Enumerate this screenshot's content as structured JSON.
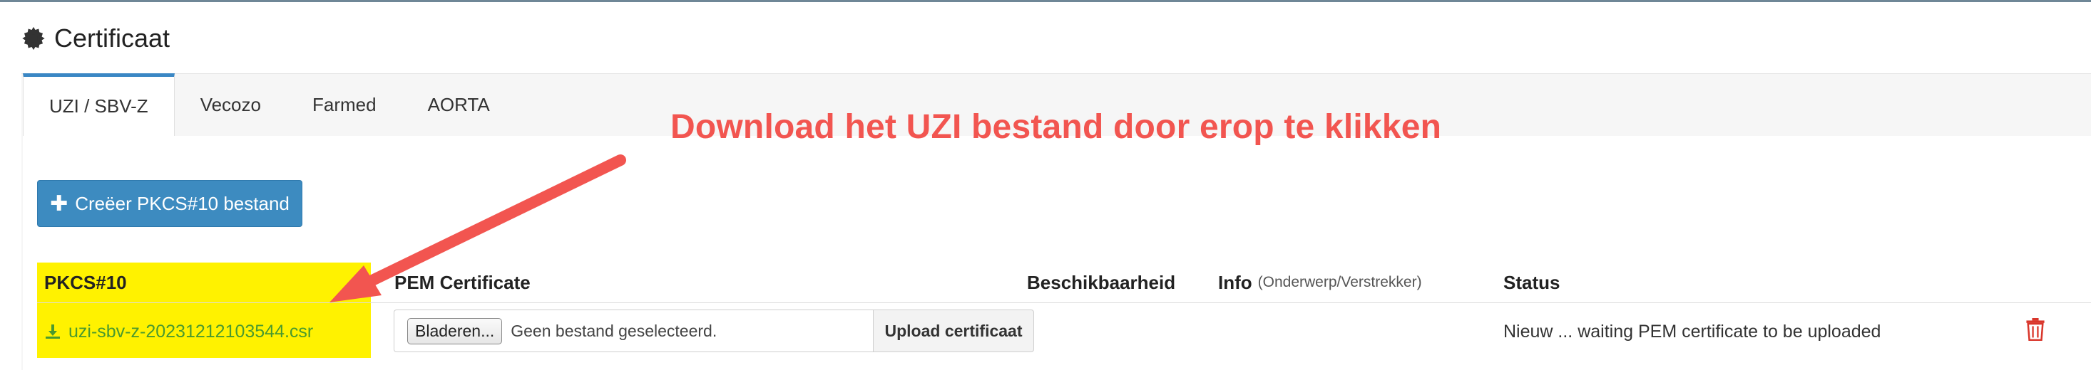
{
  "header": {
    "title": "Certificaat",
    "icon": "gear-icon"
  },
  "tabs": [
    {
      "label": "UZI / SBV-Z",
      "active": true
    },
    {
      "label": "Vecozo",
      "active": false
    },
    {
      "label": "Farmed",
      "active": false
    },
    {
      "label": "AORTA",
      "active": false
    }
  ],
  "toolbar": {
    "create_label": "Creëer PKCS#10 bestand",
    "create_icon": "plus-icon"
  },
  "table": {
    "columns": [
      {
        "label": "PKCS#10",
        "sub": ""
      },
      {
        "label": "PEM Certificate",
        "sub": ""
      },
      {
        "label": "Beschikbaarheid",
        "sub": ""
      },
      {
        "label": "Info",
        "sub": "(Onderwerp/Verstrekker)"
      },
      {
        "label": "Status",
        "sub": ""
      }
    ],
    "rows": [
      {
        "csr_file": "uzi-sbv-z-20231212103544.csr",
        "browse_label": "Bladeren...",
        "file_placeholder": "Geen bestand geselecteerd.",
        "upload_label": "Upload certificaat",
        "beschikbaarheid": "",
        "info": "",
        "status": "Nieuw ... waiting PEM certificate to be uploaded"
      }
    ]
  },
  "annotation": {
    "text": "Download het UZI bestand door erop te klikken",
    "color": "#f25550"
  },
  "colors": {
    "accent": "#3d8bc0",
    "link": "#4a9a2e",
    "highlight": "#fff200",
    "delete": "#d9362b"
  }
}
